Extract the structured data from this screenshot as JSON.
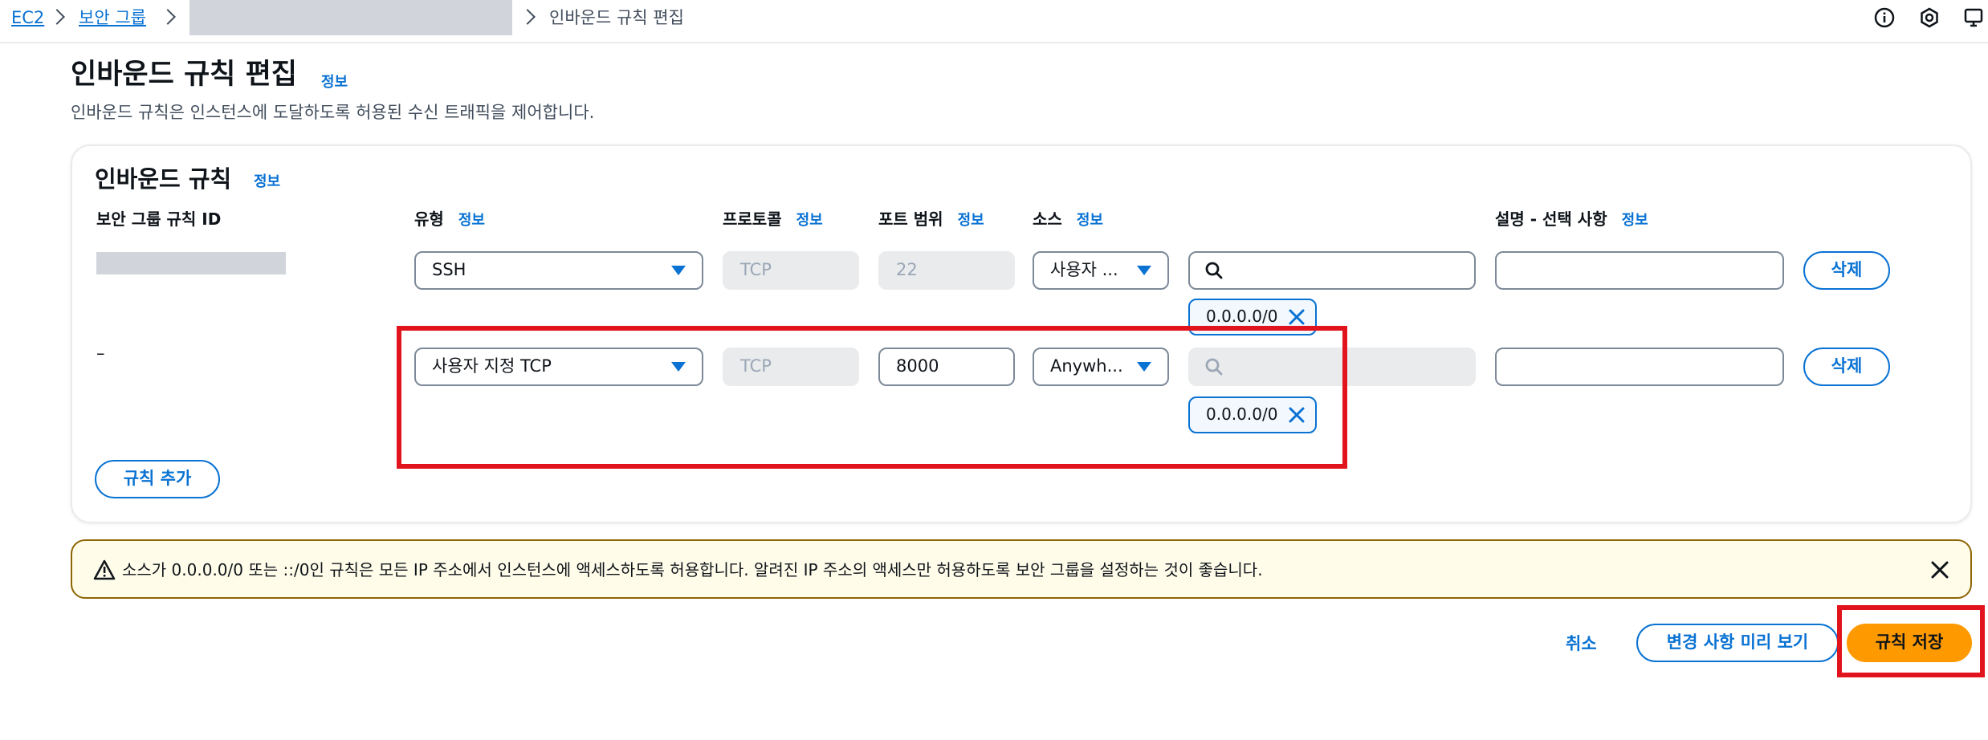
{
  "breadcrumb": {
    "items": [
      "EC2",
      "보안 그룹",
      "인바운드 규칙 편집"
    ]
  },
  "page": {
    "title": "인바운드 규칙 편집",
    "info": "정보",
    "description": "인바운드 규칙은 인스턴스에 도달하도록 허용된 수신 트래픽을 제어합니다."
  },
  "rules_panel": {
    "title": "인바운드 규칙",
    "info": "정보",
    "columns": {
      "rule_id": "보안 그룹 규칙 ID",
      "type": "유형",
      "protocol": "프로토콜",
      "port_range": "포트 범위",
      "source": "소스",
      "description": "설명 - 선택 사항",
      "info": "정보"
    },
    "rows": [
      {
        "rule_id": "",
        "type": "SSH",
        "protocol": "TCP",
        "port_range": "22",
        "source": "사용자 ...",
        "search_value": "",
        "cidr": "0.0.0.0/0",
        "description": "",
        "delete_label": "삭제"
      },
      {
        "rule_id": "–",
        "type": "사용자 지정 TCP",
        "protocol": "TCP",
        "port_range": "8000",
        "source": "Anywh...",
        "search_value": "",
        "cidr": "0.0.0.0/0",
        "description": "",
        "delete_label": "삭제"
      }
    ],
    "add_rule_label": "규칙 추가"
  },
  "alert": {
    "text": "소스가 0.0.0.0/0 또는 ::/0인 규칙은 모든 IP 주소에서 인스턴스에 액세스하도록 허용합니다. 알려진 IP 주소의 액세스만 허용하도록 보안 그룹을 설정하는 것이 좋습니다."
  },
  "footer": {
    "cancel_label": "취소",
    "preview_label": "변경 사항 미리 보기",
    "save_label": "규칙 저장"
  },
  "colors": {
    "link": "#0972d3",
    "primary": "#ff9900",
    "highlight": "#e1141e",
    "warning_border": "#8d6605"
  },
  "icons": [
    "chevron-right-icon",
    "info-icon",
    "settings-icon",
    "notifications-icon",
    "caret-down-icon",
    "search-icon",
    "close-icon",
    "warning-icon"
  ]
}
